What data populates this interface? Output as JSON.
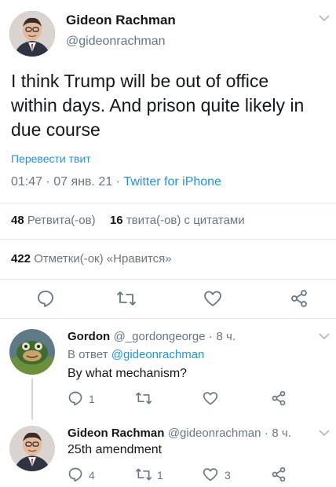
{
  "main_tweet": {
    "author_name": "Gideon Rachman",
    "author_handle": "@gideonrachman",
    "text_line1": "I think Trump will be out of office",
    "text_line2": "within days. And prison quite likely in",
    "text_line3": "due course",
    "translate_label": "Перевести твит",
    "time": "01:47",
    "date": "07 янв. 21",
    "source": "Twitter for iPhone",
    "retweets_count": "48",
    "retweets_label": "Ретвита(-ов)",
    "quotes_count": "16",
    "quotes_label": "твита(-ов) с цитатами",
    "likes_count": "422",
    "likes_label": "Отметки(-ок) «Нравится»"
  },
  "replies": [
    {
      "author_name": "Gordon",
      "author_handle": "@_gordongeorge",
      "time": "8 ч.",
      "reply_to_prefix": "В ответ",
      "reply_to_handle": "@gideonrachman",
      "text": "By what mechanism?",
      "reply_count": "1",
      "retweet_count": "",
      "like_count": ""
    },
    {
      "author_name": "Gideon Rachman",
      "author_handle": "@gideonrachman",
      "time": "8 ч.",
      "text": "25th amendment",
      "reply_count": "4",
      "retweet_count": "1",
      "like_count": "3"
    }
  ],
  "colors": {
    "link": "#1b95e0",
    "muted": "#657786",
    "divider": "#e1e8ed"
  },
  "icons": [
    "chevron-down-icon",
    "reply-icon",
    "retweet-icon",
    "like-icon",
    "share-icon"
  ]
}
